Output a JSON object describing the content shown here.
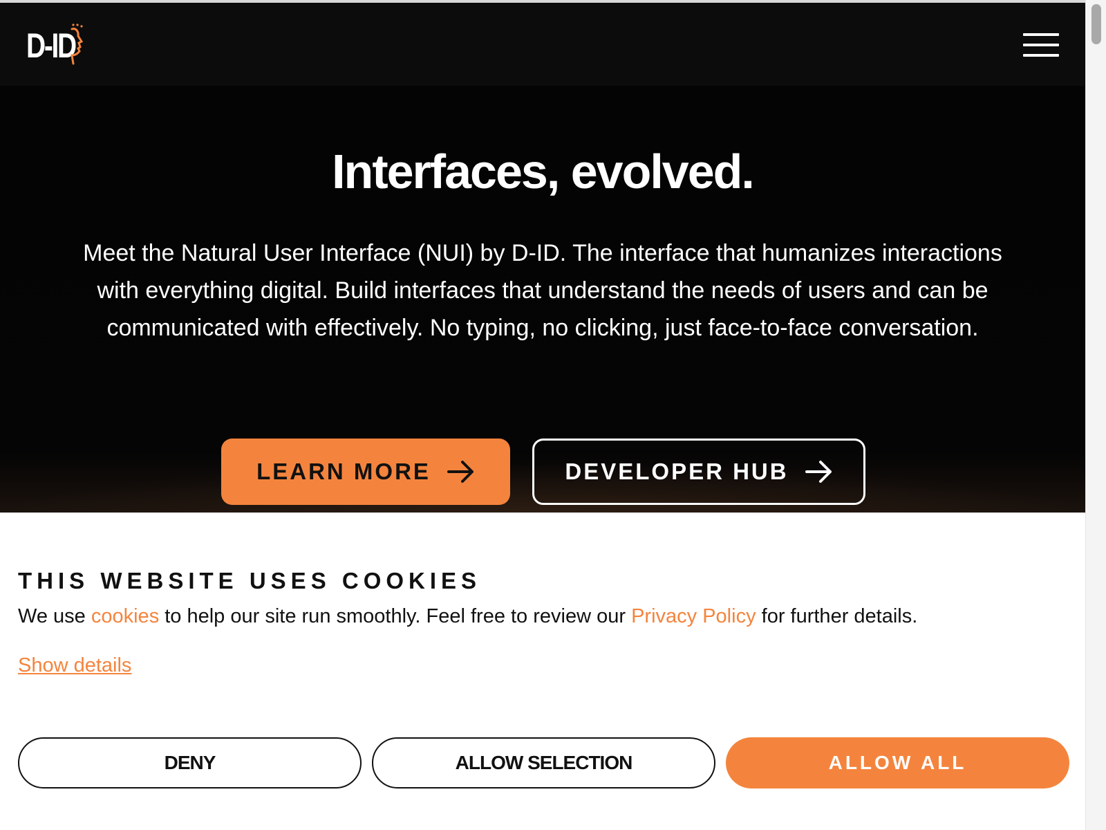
{
  "header": {
    "logo_text": "D-ID",
    "menu_icon": "hamburger-menu-icon"
  },
  "hero": {
    "title": "Interfaces, evolved.",
    "description": "Meet the Natural User Interface (NUI) by D-ID. The interface that humanizes interactions with everything digital. Build interfaces that understand the needs of users and can be communicated with effectively. No typing, no clicking, just face-to-face conversation.",
    "learn_more_label": "LEARN MORE",
    "developer_hub_label": "DEVELOPER HUB",
    "arrow_icon": "arrow-right-icon"
  },
  "cookie_banner": {
    "title": "THIS WEBSITE USES COOKIES",
    "text_1": "We use ",
    "link_cookies": "cookies",
    "text_2": " to help our site run smoothly. Feel free to review our ",
    "link_privacy": "Privacy Policy",
    "text_3": " for further details.",
    "show_details": "Show details",
    "deny_label": "DENY",
    "allow_selection_label": "ALLOW SELECTION",
    "allow_all_label": "ALLOW ALL"
  },
  "colors": {
    "accent": "#f4843d",
    "header_bg": "#0c0c0c",
    "hero_bg": "#050505",
    "text_dark": "#111111"
  }
}
